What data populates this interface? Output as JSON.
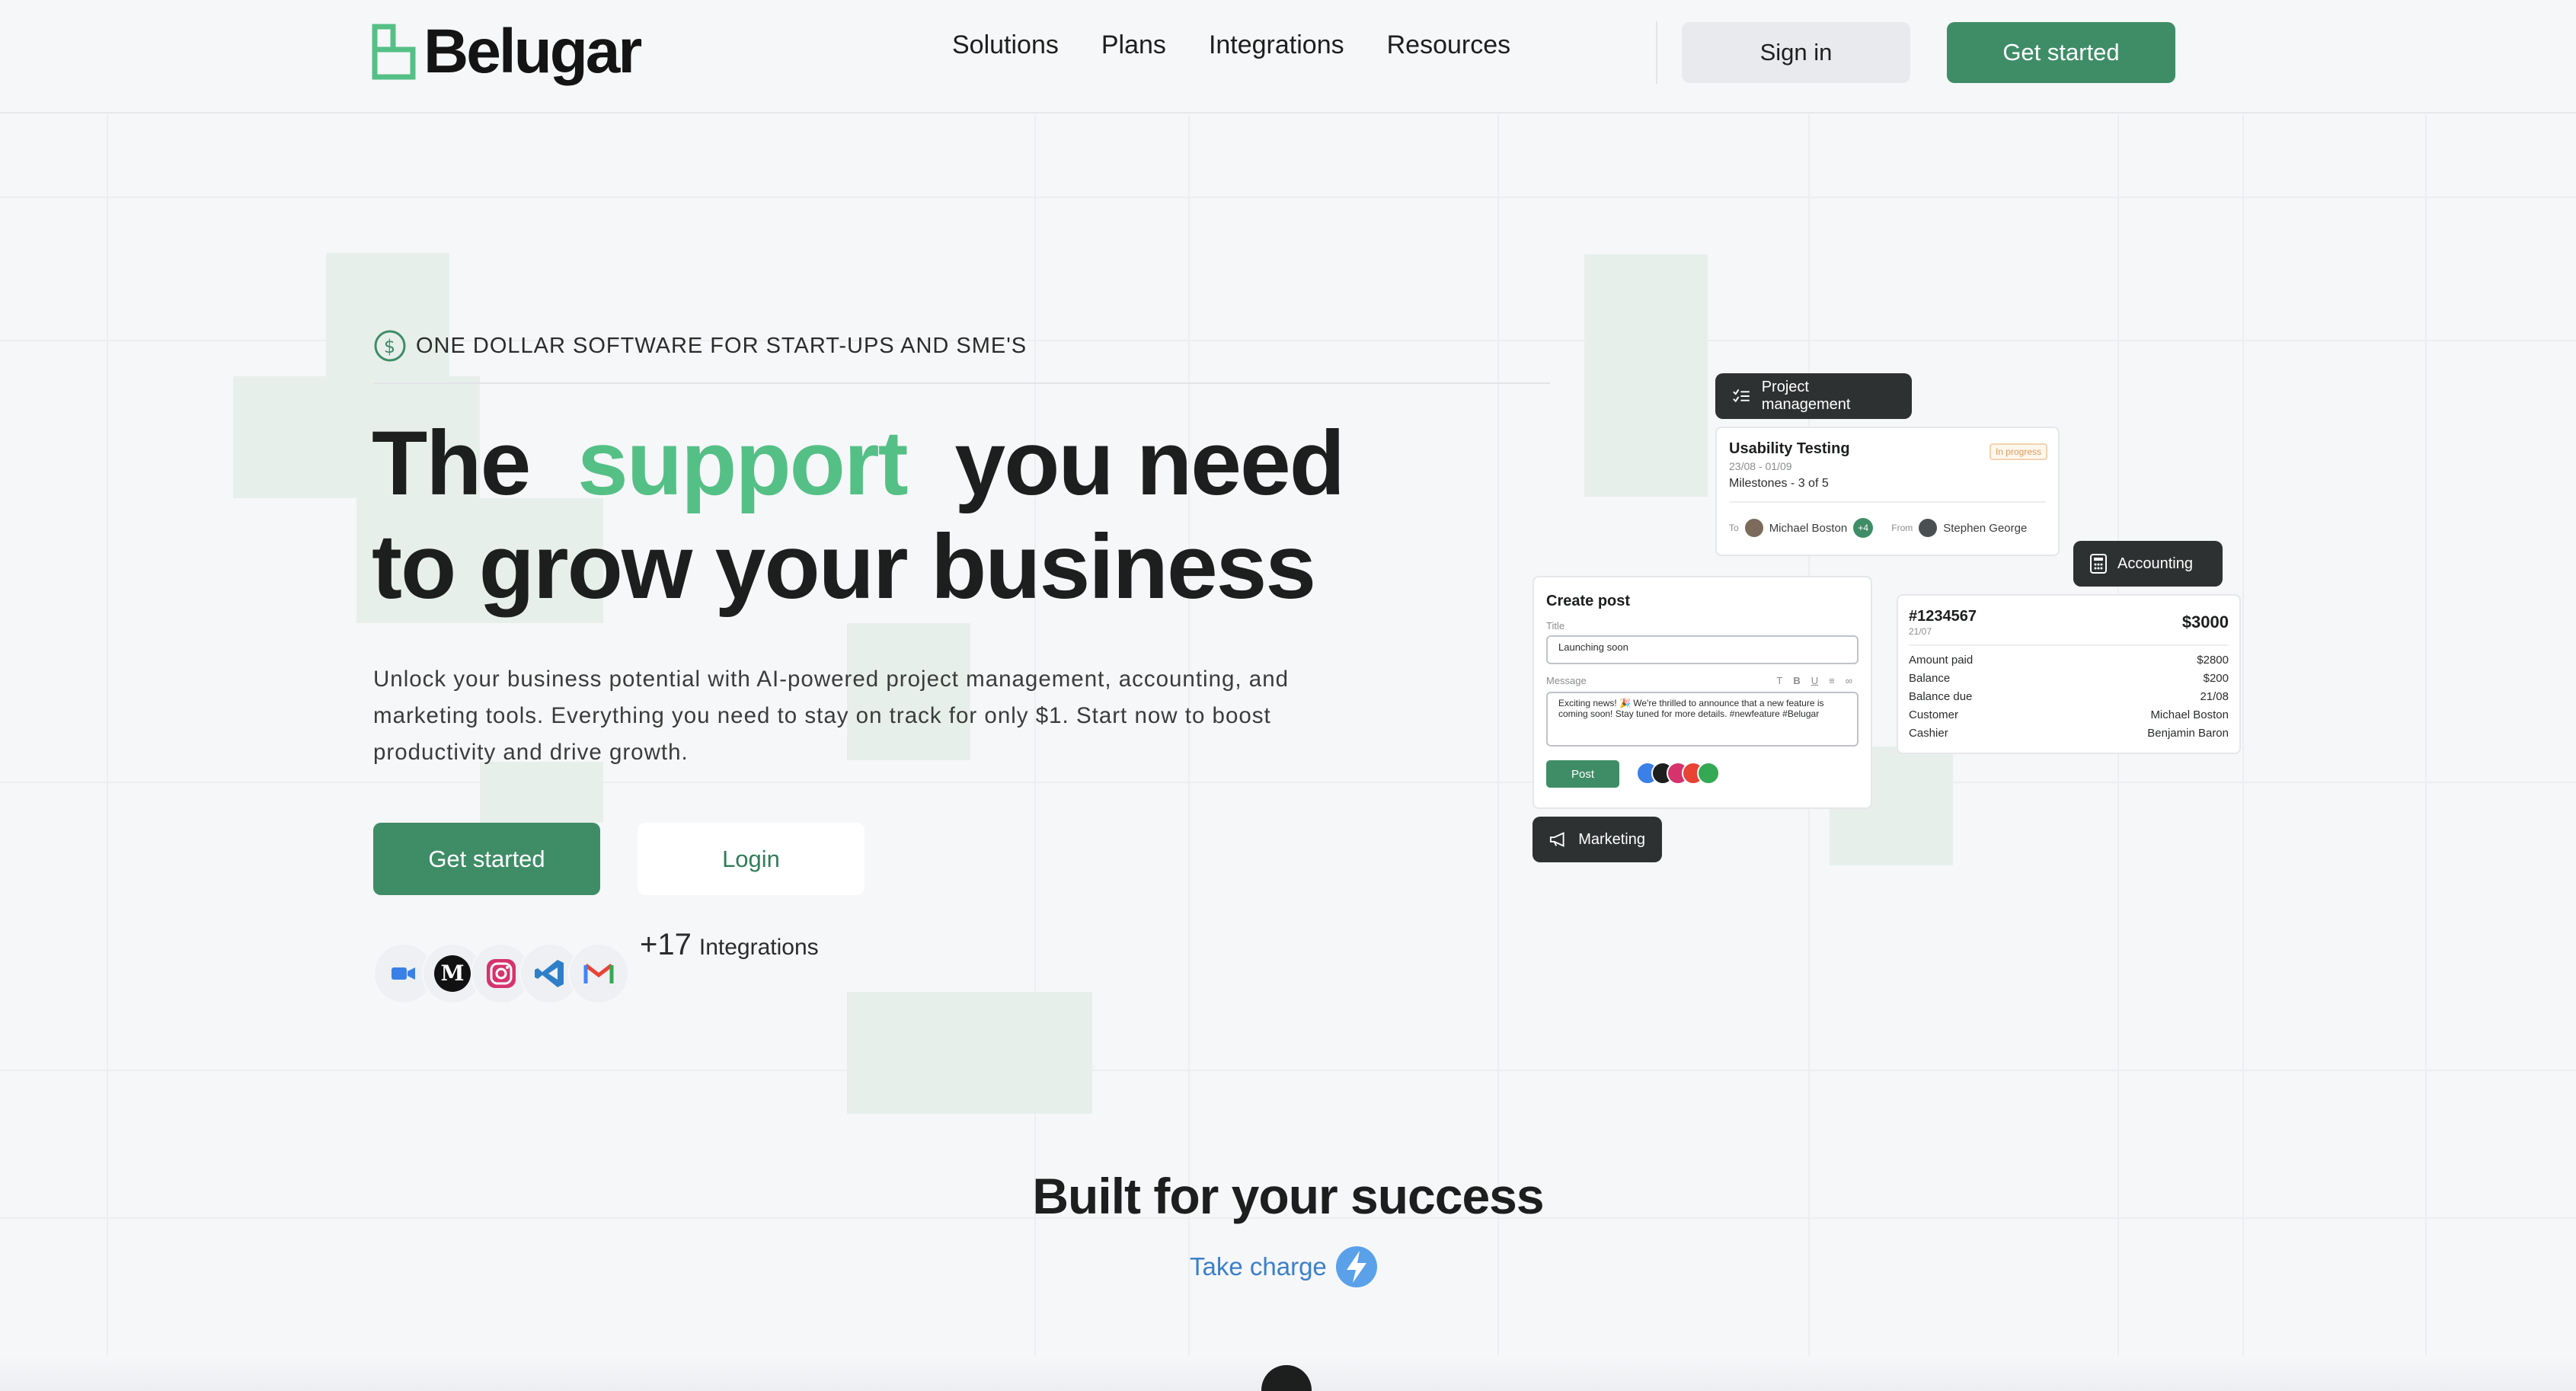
{
  "header": {
    "brand": "Belugar",
    "nav": [
      "Solutions",
      "Plans",
      "Integrations",
      "Resources"
    ],
    "sign_in": "Sign in",
    "get_started": "Get started"
  },
  "hero": {
    "tagline": "ONE DOLLAR SOFTWARE FOR START-UPS AND SME'S",
    "title_pre": "The",
    "title_accent": "support",
    "title_post": "you need",
    "title_line2": "to grow your business",
    "lead": "Unlock your business potential with AI-powered project management, accounting, and marketing tools. Everything you need to stay on track for only $1. Start now to boost productivity and drive growth.",
    "primary_button": "Get started",
    "secondary_button": "Login",
    "integration_count": "+17",
    "integration_label": "Integrations",
    "integration_icons": [
      "zoom-icon",
      "medium-icon",
      "instagram-icon",
      "vscode-icon",
      "gmail-icon"
    ]
  },
  "mock": {
    "project_pill": "Project management",
    "project_card": {
      "title": "Usability Testing",
      "status": "In progress",
      "dates": "23/08 - 01/09",
      "milestones": "Milestones - 3 of 5",
      "to_label": "To",
      "to_name": "Michael Boston",
      "to_extra": "+4",
      "from_label": "From",
      "from_name": "Stephen George"
    },
    "accounting_pill": "Accounting",
    "accounting_card": {
      "id": "#1234567",
      "date": "21/07",
      "total": "$3000",
      "rows": [
        {
          "label": "Amount paid",
          "value": "$2800"
        },
        {
          "label": "Balance",
          "value": "$200"
        },
        {
          "label": "Balance due",
          "value": "21/08"
        },
        {
          "label": "Customer",
          "value": "Michael Boston"
        },
        {
          "label": "Cashier",
          "value": "Benjamin Baron"
        }
      ]
    },
    "post_card": {
      "title": "Create post",
      "title_label": "Title",
      "title_value": "Launching soon",
      "message_label": "Message",
      "message_value": "Exciting news! 🎉 We're thrilled to announce that a new feature is coming soon! Stay tuned for more details. #newfeature #Belugar",
      "post_button": "Post"
    },
    "marketing_pill": "Marketing"
  },
  "section2": {
    "title": "Built for your success",
    "subtitle": "Take charge"
  },
  "colors": {
    "brand_green": "#3f8d67",
    "accent_green": "#55c086",
    "link_blue": "#3b80c9"
  }
}
